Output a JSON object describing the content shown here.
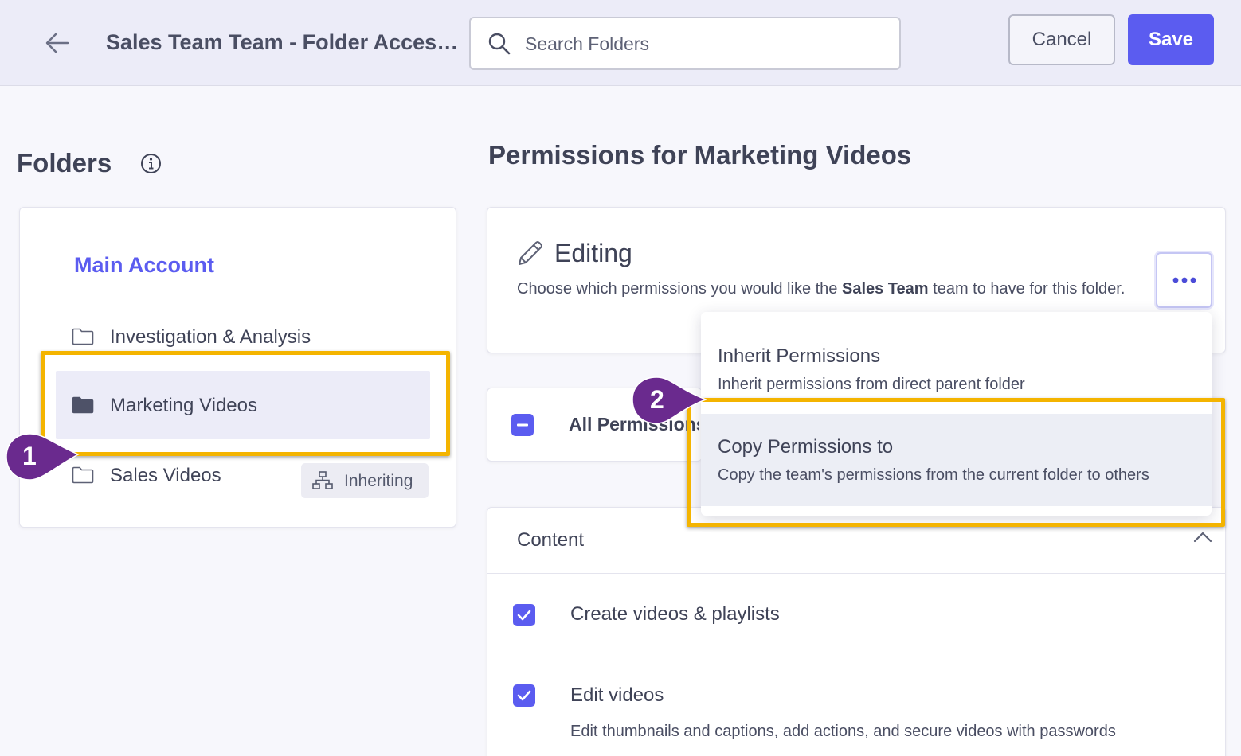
{
  "header": {
    "title": "Sales Team Team - Folder Access Settings",
    "search_placeholder": "Search Folders",
    "cancel_label": "Cancel",
    "save_label": "Save"
  },
  "folders": {
    "heading": "Folders",
    "account": "Main Account",
    "items": [
      {
        "label": "Investigation & Analysis"
      },
      {
        "label": "Marketing Videos"
      },
      {
        "label": "Sales Videos"
      }
    ],
    "inherit_badge": "Inheriting"
  },
  "permissions": {
    "heading": "Permissions for Marketing Videos",
    "editing_title": "Editing",
    "editing_desc_pre": "Choose which permissions you would like the ",
    "editing_desc_team": "Sales Team",
    "editing_desc_post": " team to have for this folder.",
    "all_label": "All Permissions",
    "content_title": "Content",
    "items": [
      {
        "label": "Create videos & playlists"
      },
      {
        "label": "Edit videos",
        "desc": "Edit thumbnails and captions, add actions, and secure videos with passwords"
      }
    ]
  },
  "menu": {
    "items": [
      {
        "title": "Inherit Permissions",
        "desc": "Inherit permissions from direct parent folder"
      },
      {
        "title": "Copy Permissions to",
        "desc": "Copy the team's permissions from the current folder to others"
      }
    ]
  },
  "callouts": [
    "1",
    "2"
  ],
  "colors": {
    "accent": "#5b5cf0",
    "highlight": "#f4b400",
    "callout": "#6a2a8e"
  }
}
